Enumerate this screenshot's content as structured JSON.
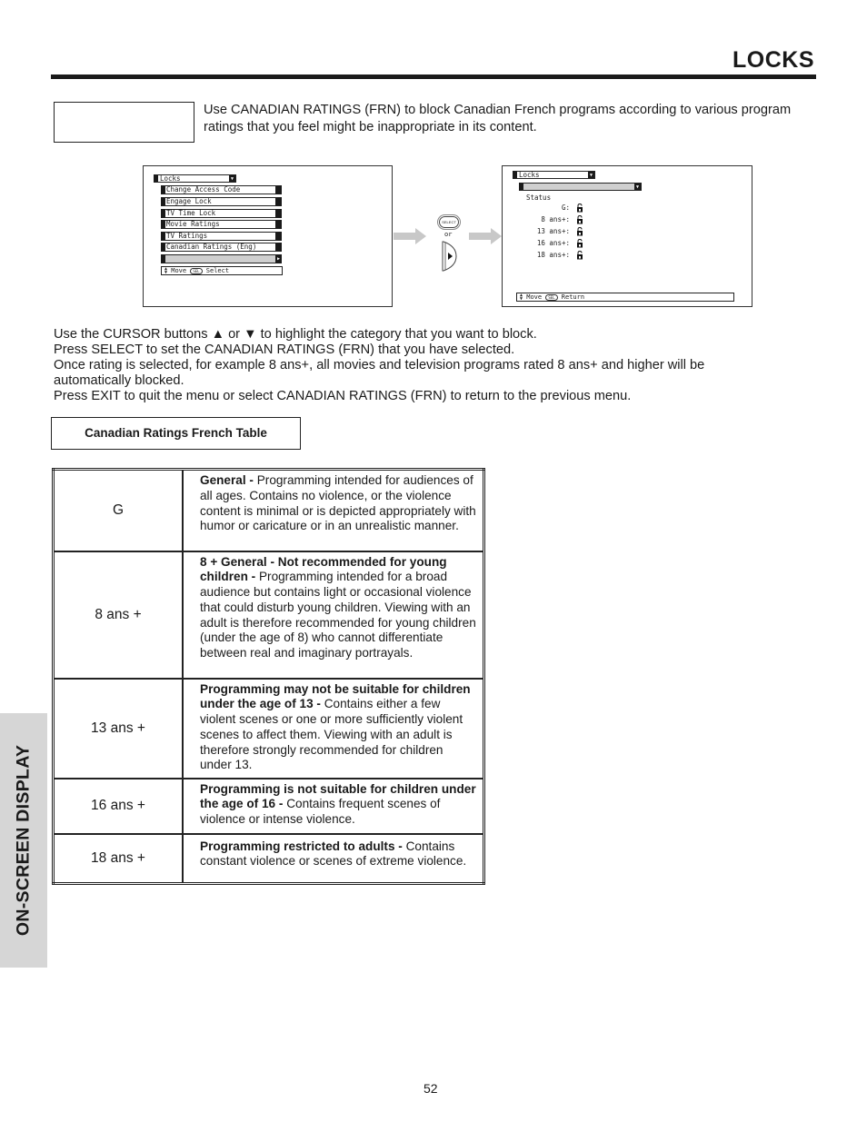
{
  "header": {
    "title": "LOCKS"
  },
  "intro": {
    "text": "Use CANADIAN RATINGS (FRN) to block Canadian French programs according to various program ratings that you feel might be inappropriate in its content."
  },
  "screen1": {
    "menu_title": "Locks",
    "items": [
      {
        "label": "Change Access Code"
      },
      {
        "label": "Engage Lock"
      },
      {
        "label": "TV Time Lock"
      },
      {
        "label": "Movie Ratings"
      },
      {
        "label": "TV Ratings"
      },
      {
        "label": "Canadian Ratings (Eng)"
      },
      {
        "label": ""
      }
    ],
    "help": {
      "move": "Move",
      "chip": "SEL",
      "action": "Select"
    }
  },
  "transition": {
    "select_button": "SELECT",
    "or": "or"
  },
  "screen2": {
    "menu_title": "Locks",
    "submenu_label": "",
    "status_label": "Status",
    "ratings": [
      {
        "label": "G:",
        "state": "unlocked"
      },
      {
        "label": "8 ans+:",
        "state": "unlocked"
      },
      {
        "label": "13 ans+:",
        "state": "unlocked"
      },
      {
        "label": "16 ans+:",
        "state": "unlocked"
      },
      {
        "label": "18 ans+:",
        "state": "unlocked"
      }
    ],
    "help": {
      "move": "Move",
      "chip": "SEL",
      "action": "Return"
    }
  },
  "instructions": [
    "Use the CURSOR buttons ▲ or ▼ to highlight the category that you want to block.",
    "Press SELECT to set the CANADIAN RATINGS (FRN) that you have selected.",
    "Once rating is selected, for example 8 ans+, all movies and television programs rated 8 ans+ and higher will be automatically blocked.",
    "Press EXIT to quit the menu or select CANADIAN RATINGS (FRN) to return to the previous menu."
  ],
  "table": {
    "title": "Canadian Ratings French Table",
    "rows": [
      {
        "code": "G",
        "heading": "General - ",
        "body": "Programming intended for audiences of all ages.  Contains no violence, or the violence content is minimal or is depicted appropriately with humor or caricature or in an unrealistic manner."
      },
      {
        "code": "8 ans +",
        "heading": "8 + General - Not recommended for young children - ",
        "body": " Programming intended for a broad audience but contains light or occasional violence that could disturb young children. Viewing with an adult is therefore recommended for young children (under the age of 8) who cannot differentiate between real and imaginary portrayals."
      },
      {
        "code": "13 ans +",
        "heading": "Programming may not be suitable for children under the age of 13 - ",
        "body": "Contains either a few violent scenes or one or more sufficiently violent scenes to affect them.  Viewing with an adult is therefore strongly recommended for children under 13."
      },
      {
        "code": "16 ans +",
        "heading": "Programming is not suitable for children under the age of 16 - ",
        "body": "Contains frequent scenes of violence or intense violence."
      },
      {
        "code": "18 ans +",
        "heading": "Programming restricted to adults - ",
        "body": " Contains constant violence or scenes of extreme violence."
      }
    ]
  },
  "side_tab": {
    "label": "ON-SCREEN DISPLAY"
  },
  "footer": {
    "page_number": "52"
  }
}
